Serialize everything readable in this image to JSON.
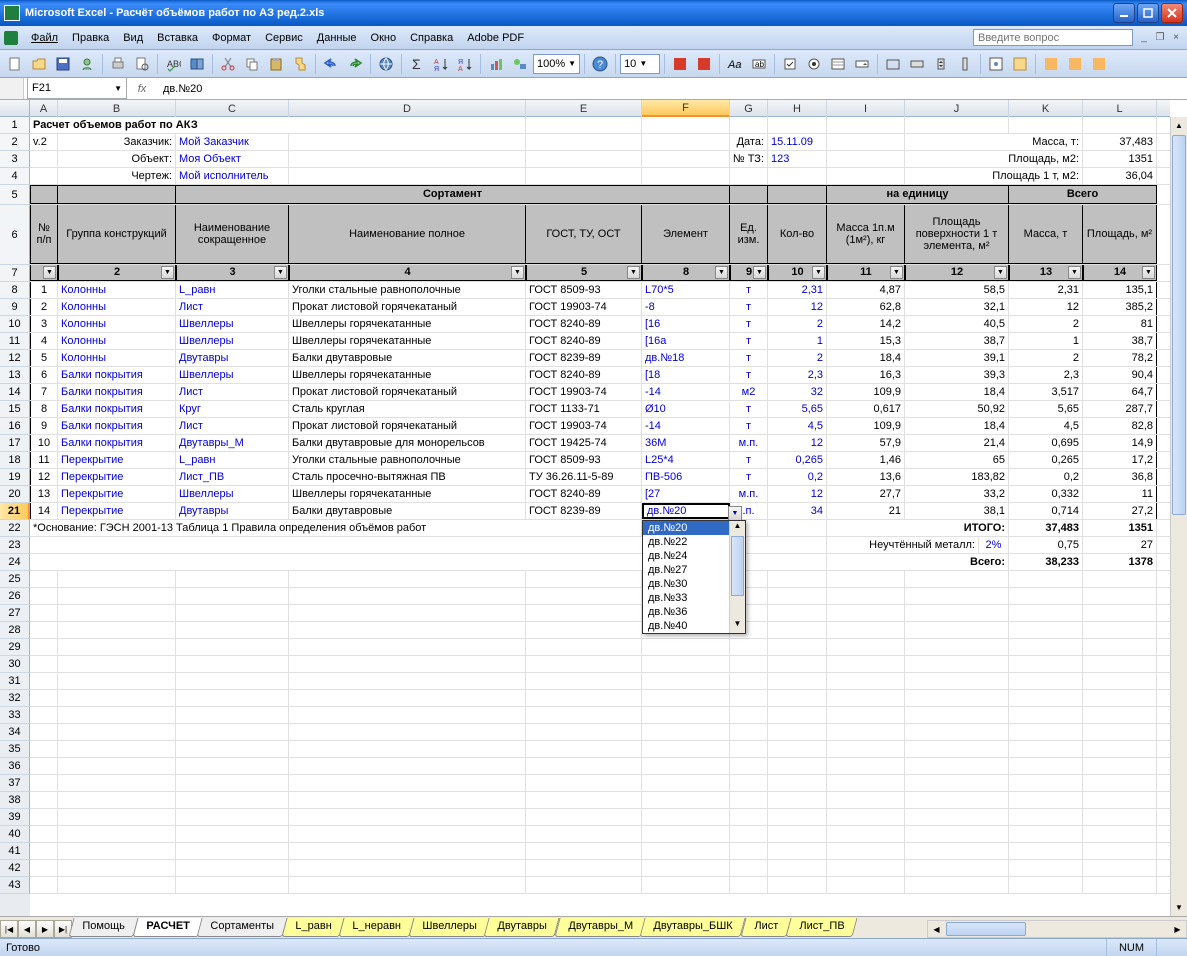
{
  "window": {
    "title": "Microsoft Excel - Расчёт объёмов работ по АЗ ред.2.xls"
  },
  "menu": [
    "Файл",
    "Правка",
    "Вид",
    "Вставка",
    "Формат",
    "Сервис",
    "Данные",
    "Окно",
    "Справка",
    "Adobe PDF"
  ],
  "askbox_placeholder": "Введите вопрос",
  "toolbar": {
    "zoom": "100%",
    "fontsize": "10"
  },
  "namebox": "F21",
  "formula": "дв.№20",
  "cols": [
    "A",
    "B",
    "C",
    "D",
    "E",
    "F",
    "G",
    "H",
    "I",
    "J",
    "K",
    "L"
  ],
  "selected_col": "F",
  "row_nums": [
    "1",
    "2",
    "3",
    "4",
    "5",
    "6",
    "7",
    "8",
    "9",
    "10",
    "11",
    "12",
    "13",
    "14",
    "15",
    "16",
    "17",
    "18",
    "19",
    "20",
    "21",
    "22",
    "23",
    "24",
    "25",
    "26",
    "27",
    "28",
    "29",
    "30",
    "31",
    "32",
    "33",
    "34",
    "35",
    "36",
    "37",
    "38",
    "39",
    "40",
    "41",
    "42",
    "43"
  ],
  "selected_row": "21",
  "meta": {
    "r1_A": "Расчет объемов работ по АКЗ",
    "r2_A": "v.2",
    "r2_B": "Заказчик:",
    "r2_C": "Мой Заказчик",
    "r2_G": "Дата:",
    "r2_H": "15.11.09",
    "r2_J": "Масса, т:",
    "r2_L": "37,483",
    "r3_B": "Объект:",
    "r3_C": "Моя Объект",
    "r3_G": "№ ТЗ:",
    "r3_H": "123",
    "r3_J": "Площадь, м2:",
    "r3_L": "1351",
    "r4_B": "Чертеж:",
    "r4_C": "Мой исполнитель",
    "r4_J": "Площадь 1 т, м2:",
    "r4_L": "36,04"
  },
  "header1": {
    "sortament": "Сортамент",
    "na_ed": "на единицу",
    "vsego": "Всего"
  },
  "header2": {
    "A": "№ п/п",
    "B": "Группа конструкций",
    "C": "Наименование сокращенное",
    "D": "Наименование полное",
    "E": "ГОСТ, ТУ, ОСТ",
    "F": "Элемент",
    "G": "Ед. изм.",
    "H": "Кол-во",
    "I": "Масса 1п.м (1м²), кг",
    "J": "Площадь поверхности 1 т элемента, м²",
    "K": "Масса, т",
    "L": "Площадь, м²"
  },
  "filter_row": [
    "",
    "2",
    "3",
    "4",
    "5",
    "8",
    "9",
    "10",
    "11",
    "12",
    "13",
    "14"
  ],
  "rows": [
    {
      "n": "1",
      "b": "Колонны",
      "c": "L_равн",
      "d": "Уголки стальные равнополочные",
      "e": "ГОСТ 8509-93",
      "f": "L70*5",
      "g": "т",
      "h": "2,31",
      "i": "4,87",
      "j": "58,5",
      "k": "2,31",
      "l": "135,1"
    },
    {
      "n": "2",
      "b": "Колонны",
      "c": "Лист",
      "d": "Прокат листовой горячекатаный",
      "e": "ГОСТ 19903-74",
      "f": "-8",
      "g": "т",
      "h": "12",
      "i": "62,8",
      "j": "32,1",
      "k": "12",
      "l": "385,2"
    },
    {
      "n": "3",
      "b": "Колонны",
      "c": "Швеллеры",
      "d": "Швеллеры горячекатанные",
      "e": "ГОСТ 8240-89",
      "f": "[16",
      "g": "т",
      "h": "2",
      "i": "14,2",
      "j": "40,5",
      "k": "2",
      "l": "81"
    },
    {
      "n": "4",
      "b": "Колонны",
      "c": "Швеллеры",
      "d": "Швеллеры горячекатанные",
      "e": "ГОСТ 8240-89",
      "f": "[16а",
      "g": "т",
      "h": "1",
      "i": "15,3",
      "j": "38,7",
      "k": "1",
      "l": "38,7"
    },
    {
      "n": "5",
      "b": "Колонны",
      "c": "Двутавры",
      "d": "Балки двутавровые",
      "e": "ГОСТ 8239-89",
      "f": "дв.№18",
      "g": "т",
      "h": "2",
      "i": "18,4",
      "j": "39,1",
      "k": "2",
      "l": "78,2"
    },
    {
      "n": "6",
      "b": "Балки покрытия",
      "c": "Швеллеры",
      "d": "Швеллеры горячекатанные",
      "e": "ГОСТ 8240-89",
      "f": "[18",
      "g": "т",
      "h": "2,3",
      "i": "16,3",
      "j": "39,3",
      "k": "2,3",
      "l": "90,4"
    },
    {
      "n": "7",
      "b": "Балки покрытия",
      "c": "Лист",
      "d": "Прокат листовой горячекатаный",
      "e": "ГОСТ 19903-74",
      "f": "-14",
      "g": "м2",
      "h": "32",
      "i": "109,9",
      "j": "18,4",
      "k": "3,517",
      "l": "64,7"
    },
    {
      "n": "8",
      "b": "Балки покрытия",
      "c": "Круг",
      "d": "Сталь круглая",
      "e": "ГОСТ 1133-71",
      "f": "Ø10",
      "g": "т",
      "h": "5,65",
      "i": "0,617",
      "j": "50,92",
      "k": "5,65",
      "l": "287,7"
    },
    {
      "n": "9",
      "b": "Балки покрытия",
      "c": "Лист",
      "d": "Прокат листовой горячекатаный",
      "e": "ГОСТ 19903-74",
      "f": "-14",
      "g": "т",
      "h": "4,5",
      "i": "109,9",
      "j": "18,4",
      "k": "4,5",
      "l": "82,8"
    },
    {
      "n": "10",
      "b": "Балки покрытия",
      "c": "Двутавры_М",
      "d": "Балки двутавровые для монорельсов",
      "e": "ГОСТ 19425-74",
      "f": "36М",
      "g": "м.п.",
      "h": "12",
      "i": "57,9",
      "j": "21,4",
      "k": "0,695",
      "l": "14,9"
    },
    {
      "n": "11",
      "b": "Перекрытие",
      "c": "L_равн",
      "d": "Уголки стальные равнополочные",
      "e": "ГОСТ 8509-93",
      "f": "L25*4",
      "g": "т",
      "h": "0,265",
      "i": "1,46",
      "j": "65",
      "k": "0,265",
      "l": "17,2"
    },
    {
      "n": "12",
      "b": "Перекрытие",
      "c": "Лист_ПВ",
      "d": "Сталь просечно-вытяжная ПВ",
      "e": "ТУ 36.26.11-5-89",
      "f": "ПВ-506",
      "g": "т",
      "h": "0,2",
      "i": "13,6",
      "j": "183,82",
      "k": "0,2",
      "l": "36,8"
    },
    {
      "n": "13",
      "b": "Перекрытие",
      "c": "Швеллеры",
      "d": "Швеллеры горячекатанные",
      "e": "ГОСТ 8240-89",
      "f": "[27",
      "g": "м.п.",
      "h": "12",
      "i": "27,7",
      "j": "33,2",
      "k": "0,332",
      "l": "11"
    },
    {
      "n": "14",
      "b": "Перекрытие",
      "c": "Двутавры",
      "d": "Балки двутавровые",
      "e": "ГОСТ 8239-89",
      "f": "дв.№20",
      "g": ".п.",
      "h": "34",
      "i": "21",
      "j": "38,1",
      "k": "0,714",
      "l": "27,2"
    }
  ],
  "footnote": "*Основание: ГЭСН 2001-13 Таблица 1 Правила определения объёмов работ",
  "totals": {
    "itogo_lbl": "ИТОГО:",
    "itogo_k": "37,483",
    "itogo_l": "1351",
    "neuch_lbl": "Неучтённый металл:",
    "neuch_j": "2%",
    "neuch_k": "0,75",
    "neuch_l": "27",
    "vsego_lbl": "Всего:",
    "vsego_k": "38,233",
    "vsego_l": "1378"
  },
  "dropdown": {
    "value": "дв.№20",
    "items": [
      "дв.№20",
      "дв.№22",
      "дв.№24",
      "дв.№27",
      "дв.№30",
      "дв.№33",
      "дв.№36",
      "дв.№40"
    ]
  },
  "tabs": [
    "Помощь",
    "РАСЧЕТ",
    "Сортаменты",
    "L_равн",
    "L_неравн",
    "Швеллеры",
    "Двутавры",
    "Двутавры_М",
    "Двутавры_БШК",
    "Лист",
    "Лист_ПВ"
  ],
  "active_tab": "РАСЧЕТ",
  "status": {
    "ready": "Готово",
    "num": "NUM"
  }
}
